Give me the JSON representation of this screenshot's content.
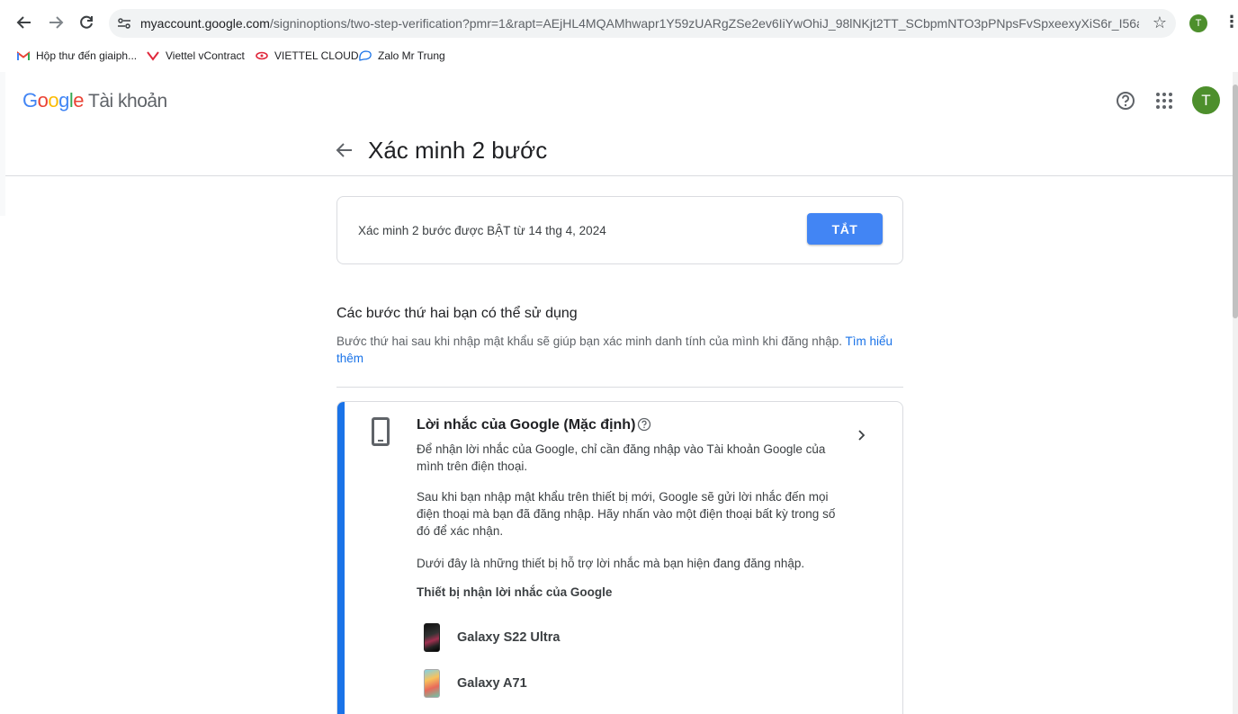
{
  "browser": {
    "url_host": "myaccount.google.com",
    "url_path": "/signinoptions/two-step-verification?pmr=1&rapt=AEjHL4MQAMhwapr1Y59zUARgZSe2ev6IiYwOhiJ_98lNKjt2TT_SCbpmNTO3pPNpsFvSpxeexyXiS6r_I56aMxcQJPN...",
    "profile_initial": "T",
    "bookmarks": [
      {
        "label": "Hộp thư đến giaiph...",
        "icon": "gmail-icon"
      },
      {
        "label": "Viettel vContract",
        "icon": "viettel-icon"
      },
      {
        "label": "VIETTEL CLOUD",
        "icon": "viettel-cloud-icon"
      },
      {
        "label": "Zalo Mr Trung",
        "icon": "zalo-icon"
      }
    ]
  },
  "header": {
    "logo_letters": [
      "G",
      "o",
      "o",
      "g",
      "l",
      "e"
    ],
    "product": "Tài khoản",
    "avatar_initial": "T"
  },
  "page": {
    "title": "Xác minh 2 bước"
  },
  "status": {
    "text": "Xác minh 2 bước được BẬT từ 14 thg 4, 2024",
    "button": "TẮT"
  },
  "section": {
    "title": "Các bước thứ hai bạn có thể sử dụng",
    "desc": "Bước thứ hai sau khi nhập mật khẩu sẽ giúp bạn xác minh danh tính của mình khi đăng nhập.",
    "link": "Tìm hiểu thêm"
  },
  "method": {
    "title": "Lời nhắc của Google (Mặc định)",
    "p1": "Để nhận lời nhắc của Google, chỉ cần đăng nhập vào Tài khoản Google của mình trên điện thoại.",
    "p2": "Sau khi bạn nhập mật khẩu trên thiết bị mới, Google sẽ gửi lời nhắc đến mọi điện thoại mà bạn đã đăng nhập. Hãy nhấn vào một điện thoại bất kỳ trong số đó để xác nhận.",
    "p3": "Dưới đây là những thiết bị hỗ trợ lời nhắc mà bạn hiện đang đăng nhập.",
    "devices_title": "Thiết bị nhận lời nhắc của Google",
    "devices": [
      {
        "name": "Galaxy S22 Ultra"
      },
      {
        "name": "Galaxy A71"
      }
    ]
  },
  "colors": {
    "accent": "#1a73e8",
    "button": "#4285f4",
    "avatar": "#4d8f2c"
  }
}
